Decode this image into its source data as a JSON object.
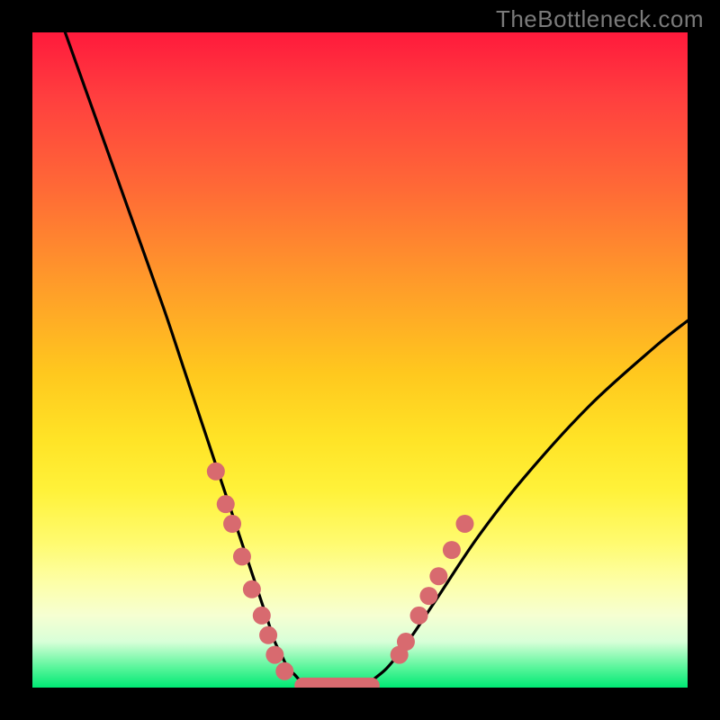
{
  "watermark": "TheBottleneck.com",
  "chart_data": {
    "type": "line",
    "title": "",
    "xlabel": "",
    "ylabel": "",
    "xlim": [
      0,
      100
    ],
    "ylim": [
      0,
      100
    ],
    "grid": false,
    "legend": false,
    "series": [
      {
        "name": "bottleneck-curve",
        "x": [
          5,
          10,
          15,
          20,
          23,
          25,
          27,
          29,
          31,
          33,
          35,
          36,
          37,
          38,
          39,
          40,
          42,
          44,
          47,
          50,
          53,
          55,
          58,
          62,
          68,
          75,
          85,
          95,
          100
        ],
        "y": [
          100,
          86,
          72,
          58,
          49,
          43,
          37,
          31,
          25,
          19,
          13,
          10,
          7,
          5,
          3,
          2,
          0,
          0,
          0,
          0,
          2,
          4,
          8,
          14,
          23,
          32,
          43,
          52,
          56
        ]
      }
    ],
    "markers": {
      "name": "highlighted-points",
      "color": "#d86a6f",
      "points": [
        {
          "x": 28,
          "y": 33
        },
        {
          "x": 29.5,
          "y": 28
        },
        {
          "x": 30.5,
          "y": 25
        },
        {
          "x": 32,
          "y": 20
        },
        {
          "x": 33.5,
          "y": 15
        },
        {
          "x": 35,
          "y": 11
        },
        {
          "x": 36,
          "y": 8
        },
        {
          "x": 37,
          "y": 5
        },
        {
          "x": 38.5,
          "y": 2.5
        },
        {
          "x": 56,
          "y": 5
        },
        {
          "x": 57,
          "y": 7
        },
        {
          "x": 59,
          "y": 11
        },
        {
          "x": 60.5,
          "y": 14
        },
        {
          "x": 62,
          "y": 17
        },
        {
          "x": 64,
          "y": 21
        },
        {
          "x": 66,
          "y": 25
        }
      ],
      "flat_segment": {
        "x0": 40,
        "x1": 53,
        "y": 0.3,
        "thickness": 3
      }
    },
    "background_gradient_stops": [
      {
        "pos": 0.0,
        "color": "#ff1a3c"
      },
      {
        "pos": 0.1,
        "color": "#ff3f3f"
      },
      {
        "pos": 0.24,
        "color": "#ff6a36"
      },
      {
        "pos": 0.38,
        "color": "#ff9a2a"
      },
      {
        "pos": 0.52,
        "color": "#ffc81e"
      },
      {
        "pos": 0.62,
        "color": "#ffe326"
      },
      {
        "pos": 0.7,
        "color": "#fff23a"
      },
      {
        "pos": 0.78,
        "color": "#fffb70"
      },
      {
        "pos": 0.84,
        "color": "#fdffa8"
      },
      {
        "pos": 0.89,
        "color": "#f6ffd2"
      },
      {
        "pos": 0.93,
        "color": "#d8ffd8"
      },
      {
        "pos": 0.97,
        "color": "#57f59a"
      },
      {
        "pos": 1.0,
        "color": "#00e874"
      }
    ]
  }
}
